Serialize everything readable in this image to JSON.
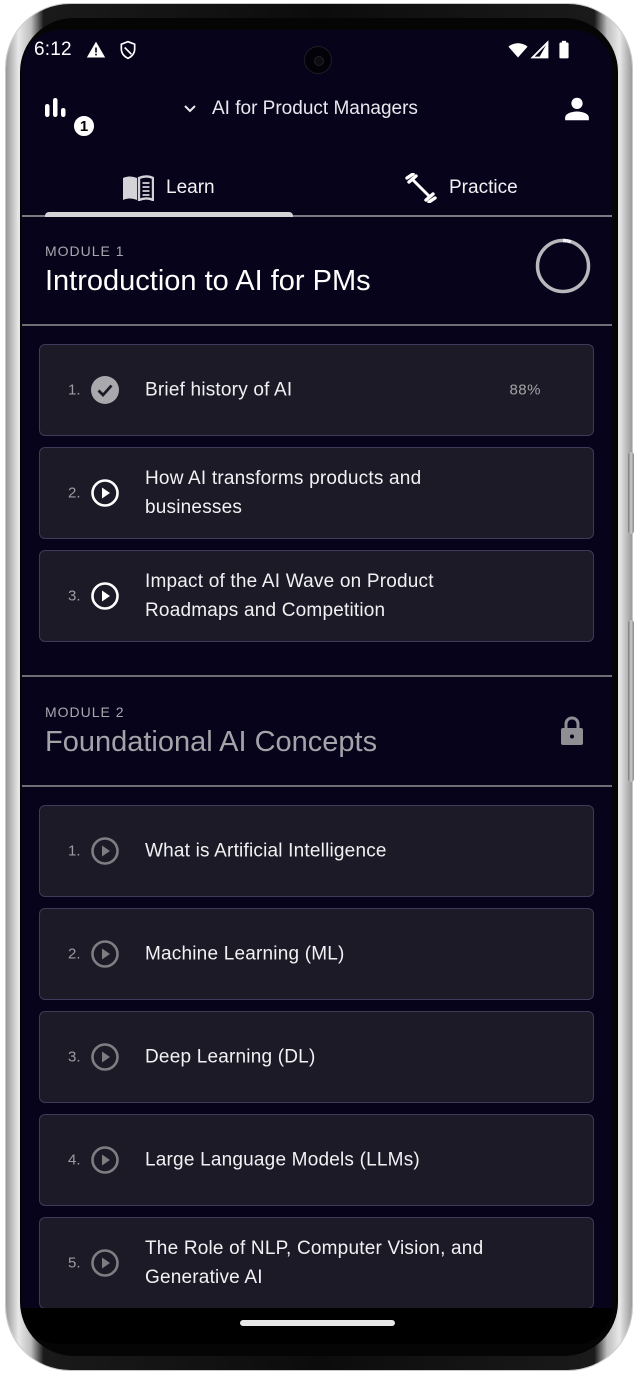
{
  "status_bar": {
    "time": "6:12",
    "left_icons": [
      "warning-icon",
      "shield-icon"
    ],
    "right_icons": [
      "wifi-icon",
      "cellular-icon",
      "battery-icon"
    ]
  },
  "app_bar": {
    "stats_icon": "bar-chart-icon",
    "badge_count": "1",
    "course_title": "AI for Product Managers",
    "dropdown_icon": "chevron-down-icon",
    "profile_icon": "person-icon"
  },
  "tabs": [
    {
      "label": "Learn",
      "icon": "book-icon",
      "selected": true
    },
    {
      "label": "Practice",
      "icon": "dumbbell-icon",
      "selected": false
    }
  ],
  "modules": [
    {
      "label": "MODULE 1",
      "title": "Introduction to AI for PMs",
      "status_icon": "progress-ring",
      "progress": 0.05,
      "locked": false,
      "lessons": [
        {
          "number": "1.",
          "title": "Brief history of AI",
          "status": "completed",
          "icon": "check-circle-icon",
          "score": "88%"
        },
        {
          "number": "2.",
          "title": "How AI transforms products and businesses",
          "status": "available",
          "icon": "play-circle-icon"
        },
        {
          "number": "3.",
          "title": "Impact of the AI Wave on Product Roadmaps and Competition",
          "status": "available",
          "icon": "play-circle-icon"
        }
      ]
    },
    {
      "label": "MODULE 2",
      "title": "Foundational AI Concepts",
      "status_icon": "lock-icon",
      "locked": true,
      "lessons": [
        {
          "number": "1.",
          "title": "What is Artificial Intelligence",
          "status": "locked",
          "icon": "play-circle-icon"
        },
        {
          "number": "2.",
          "title": "Machine Learning (ML)",
          "status": "locked",
          "icon": "play-circle-icon"
        },
        {
          "number": "3.",
          "title": "Deep Learning (DL)",
          "status": "locked",
          "icon": "play-circle-icon"
        },
        {
          "number": "4.",
          "title": "Large Language Models (LLMs)",
          "status": "locked",
          "icon": "play-circle-icon"
        },
        {
          "number": "5.",
          "title": "The Role of NLP, Computer Vision, and Generative AI",
          "status": "locked",
          "icon": "play-circle-icon"
        }
      ]
    }
  ],
  "colors": {
    "background": "#06031a",
    "card_background": "#1b1a26",
    "card_border": "#3d3a5a",
    "text_primary": "#ffffff",
    "text_muted": "#a3a3a8"
  }
}
